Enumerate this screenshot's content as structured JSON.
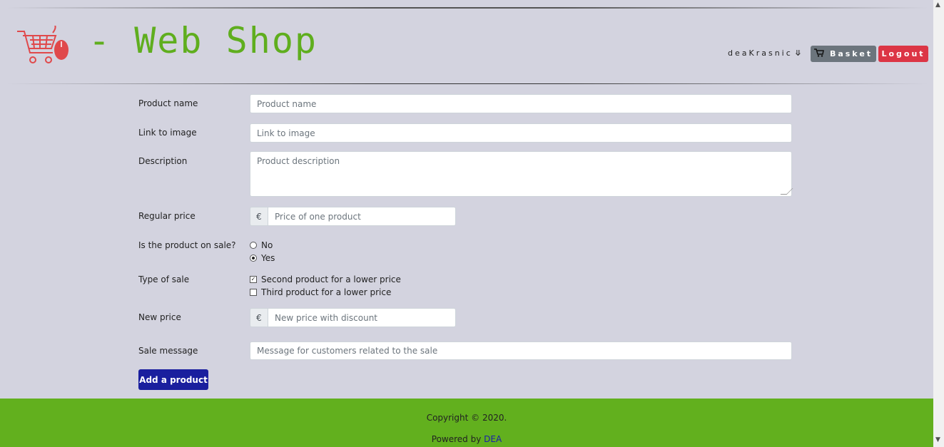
{
  "header": {
    "brand_title": "- Web Shop",
    "username": "deaKrasnic",
    "basket_label": "Basket",
    "logout_label": "Logout"
  },
  "form": {
    "product_name_label": "Product name",
    "product_name_placeholder": "Product name",
    "image_link_label": "Link to image",
    "image_link_placeholder": "Link to image",
    "description_label": "Description",
    "description_placeholder": "Product description",
    "regular_price_label": "Regular price",
    "currency_symbol": "€",
    "regular_price_placeholder": "Price of one product",
    "on_sale_label": "Is the product on sale?",
    "on_sale_options": [
      {
        "label": "No",
        "selected": false
      },
      {
        "label": "Yes",
        "selected": true
      }
    ],
    "sale_type_label": "Type of sale",
    "sale_type_options": [
      {
        "label": "Second product for a lower price",
        "checked": true
      },
      {
        "label": "Third product for a lower price",
        "checked": false
      }
    ],
    "new_price_label": "New price",
    "new_price_placeholder": "New price with discount",
    "sale_message_label": "Sale message",
    "sale_message_placeholder": "Message for customers related to the sale",
    "submit_label": "Add a product"
  },
  "footer": {
    "copyright": "Copyright © 2020.",
    "powered_prefix": "Powered by",
    "powered_link": "DEA"
  },
  "colors": {
    "brand_green": "#5fae1e",
    "basket_gray": "#6c757d",
    "logout_red": "#dc3545",
    "submit_blue": "#1a1f9e",
    "background": "#d3d3df"
  },
  "icons": [
    "cart-logo-icon",
    "chevron-down-icon",
    "cart-icon"
  ]
}
